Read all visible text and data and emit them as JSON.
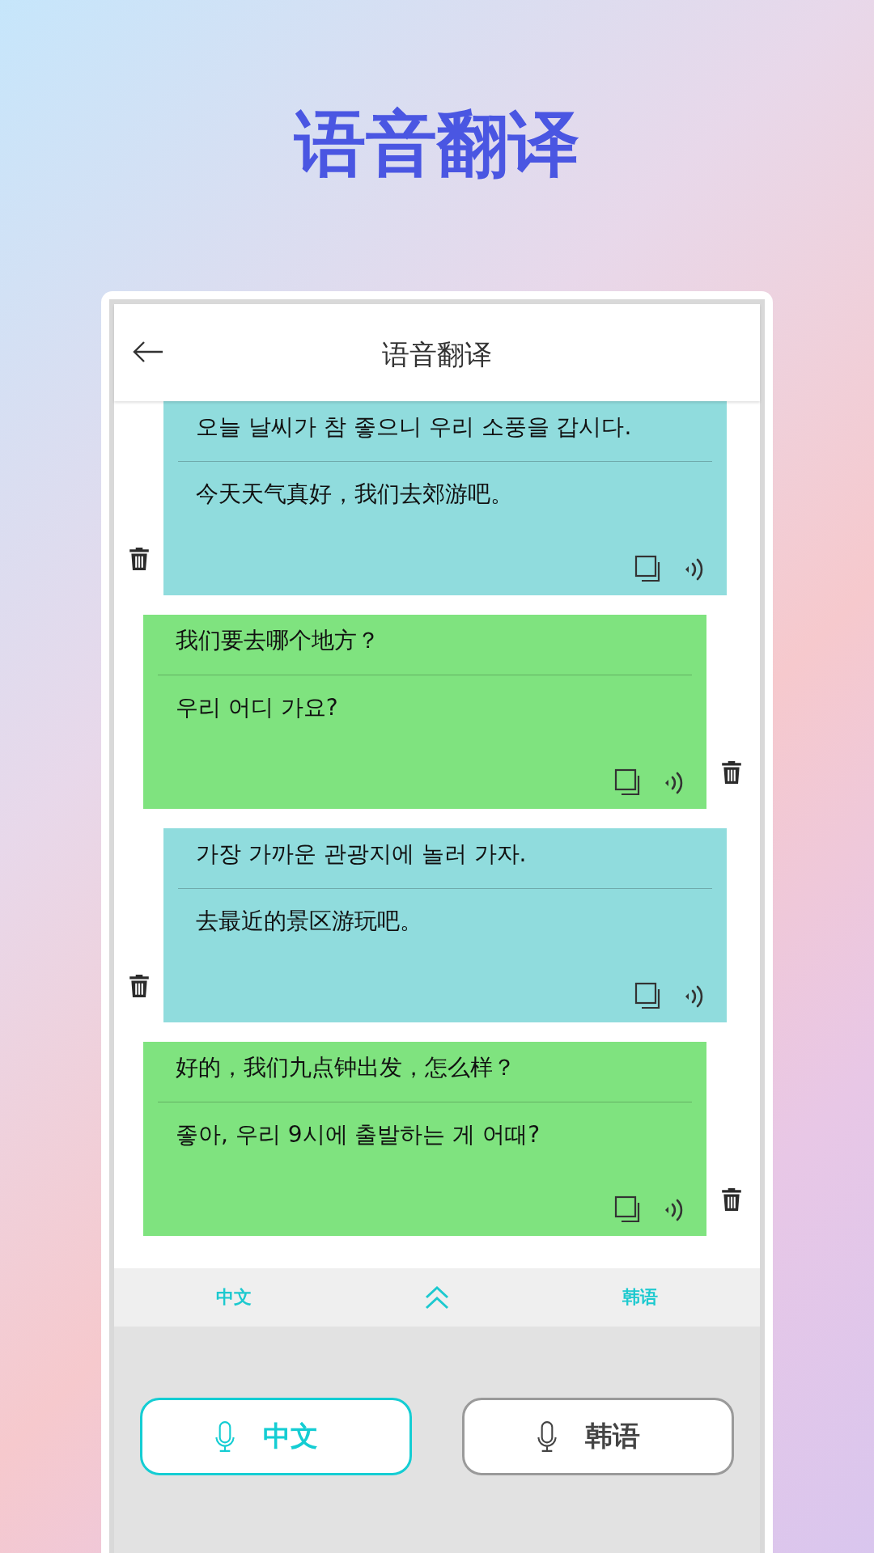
{
  "banner_title": "语音翻译",
  "app_bar": {
    "title": "语音翻译"
  },
  "messages": [
    {
      "kind": "incoming",
      "source": "오늘 날씨가 참 좋으니 우리 소풍을 갑시다.",
      "translation": "今天天气真好，我们去郊游吧。"
    },
    {
      "kind": "outgoing",
      "source": "我们要去哪个地方？",
      "translation": "우리 어디 가요?"
    },
    {
      "kind": "incoming",
      "source": "가장 가까운 관광지에 놀러 가자.",
      "translation": "去最近的景区游玩吧。"
    },
    {
      "kind": "outgoing",
      "source": "好的，我们九点钟出发，怎么样？",
      "translation": "좋아, 우리 9시에 출발하는 게 어때?"
    }
  ],
  "language_bar": {
    "left": "中文",
    "right": "韩语"
  },
  "speak_buttons": [
    {
      "label": "中文",
      "selected": true
    },
    {
      "label": "韩语",
      "selected": false
    }
  ]
}
